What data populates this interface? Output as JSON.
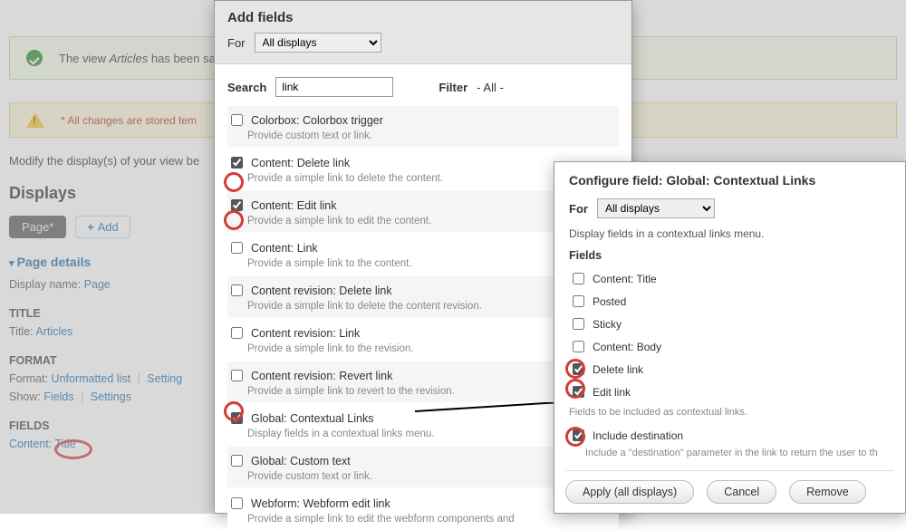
{
  "status_message": {
    "pre": "The view ",
    "italic": "Articles",
    "post": " has been sa"
  },
  "warning_message": "* All changes are stored tem",
  "below_desc": "Modify the display(s) of your view be",
  "displays_heading": "Displays",
  "page_tab": "Page*",
  "add_button": "Add",
  "page_details": "Page details",
  "display_name_label": "Display name:",
  "display_name_value": "Page",
  "title_h": "TITLE",
  "title_label": "Title:",
  "title_value": "Articles",
  "format_h": "FORMAT",
  "format_label": "Format:",
  "format_value": "Unformatted list",
  "settings_text": "Setting",
  "show_label": "Show:",
  "show_value": "Fields",
  "show_settings": "Settings",
  "fields_h": "FIELDS",
  "field_content_title": "Content: Title",
  "add_fields": {
    "title": "Add fields",
    "for_label": "For",
    "for_value": "All displays",
    "search_label": "Search",
    "search_value": "link",
    "filter_label": "Filter",
    "filter_value": "- All -",
    "rows": [
      {
        "checked": false,
        "title": "Colorbox: Colorbox trigger",
        "desc": "Provide custom text or link."
      },
      {
        "checked": true,
        "title": "Content: Delete link",
        "desc": "Provide a simple link to delete the content."
      },
      {
        "checked": true,
        "title": "Content: Edit link",
        "desc": "Provide a simple link to edit the content."
      },
      {
        "checked": false,
        "title": "Content: Link",
        "desc": "Provide a simple link to the content."
      },
      {
        "checked": false,
        "title": "Content revision: Delete link",
        "desc": "Provide a simple link to delete the content revision."
      },
      {
        "checked": false,
        "title": "Content revision: Link",
        "desc": "Provide a simple link to the revision."
      },
      {
        "checked": false,
        "title": "Content revision: Revert link",
        "desc": "Provide a simple link to revert to the revision."
      },
      {
        "checked": true,
        "title": "Global: Contextual Links",
        "desc": "Display fields in a contextual links menu."
      },
      {
        "checked": false,
        "title": "Global: Custom text",
        "desc": "Provide custom text or link."
      },
      {
        "checked": false,
        "title": "Webform: Webform edit link",
        "desc": "Provide a simple link to edit the webform components and"
      }
    ]
  },
  "config": {
    "title": "Configure field: Global: Contextual Links",
    "for_label": "For",
    "for_value": "All displays",
    "desc": "Display fields in a contextual links menu.",
    "fields_h": "Fields",
    "items": [
      {
        "checked": false,
        "label": "Content: Title"
      },
      {
        "checked": false,
        "label": "Posted"
      },
      {
        "checked": false,
        "label": "Sticky"
      },
      {
        "checked": false,
        "label": "Content: Body"
      },
      {
        "checked": true,
        "label": "Delete link"
      },
      {
        "checked": true,
        "label": "Edit link"
      }
    ],
    "fields_help": "Fields to be included as contextual links.",
    "dest_checked": true,
    "dest_label": "Include destination",
    "dest_help": "Include a \"destination\" parameter in the link to return the user to th",
    "btn_apply": "Apply (all displays)",
    "btn_cancel": "Cancel",
    "btn_remove": "Remove"
  }
}
